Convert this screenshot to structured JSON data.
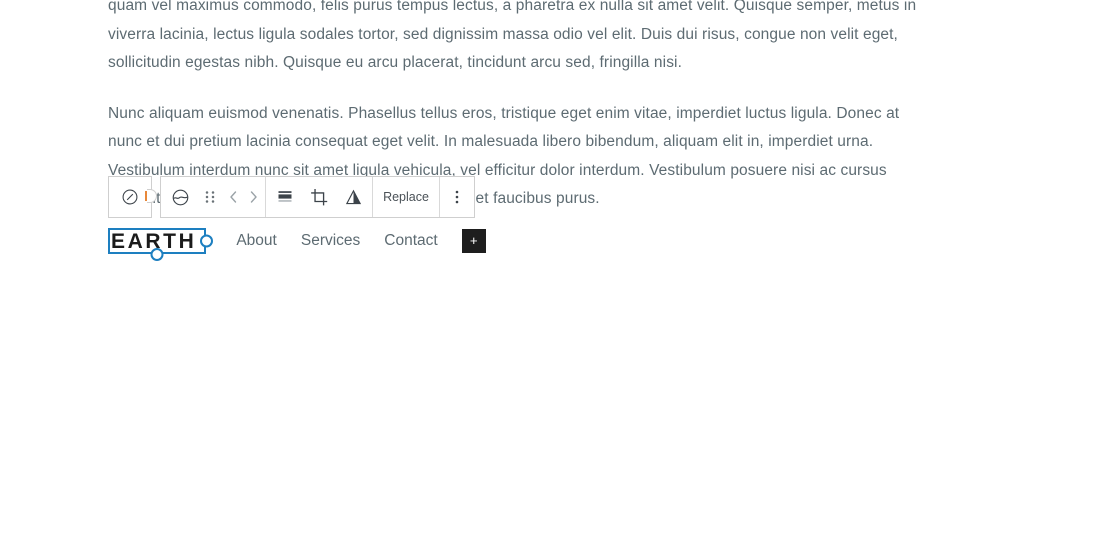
{
  "document": {
    "paragraphs": [
      "quam vel maximus commodo, felis purus tempus lectus, a pharetra ex nulla sit amet velit. Quisque semper, metus in viverra lacinia, lectus ligula sodales tortor, sed dignissim massa odio vel elit. Duis dui risus, congue non velit eget, sollicitudin egestas nibh. Quisque eu arcu placerat, tincidunt arcu sed, fringilla nisi.",
      "Nunc aliquam euismod venenatis. Phasellus tellus eros, tristique eget enim vitae, imperdiet luctus ligula. Donec at nunc et dui pretium lacinia consequat eget velit. In malesuada libero bibendum, aliquam elit in, imperdiet urna. Vestibulum interdum nunc sit amet ligula vehicula, vel efficitur dolor interdum. Vestibulum posuere nisi ac cursus suscipit. Donec porttitor, lacus nec lacinia finibus ex, et faucibus purus."
    ]
  },
  "block_toolbar": {
    "parent_block_label": "select-parent-block",
    "block_type_label": "image-block",
    "drag_label": "drag-handle",
    "move_prev_label": "‹",
    "move_next_label": "›",
    "align_label": "align",
    "crop_label": "crop",
    "filter_label": "duotone-filter",
    "replace_label": "Replace",
    "more_label": "more-options"
  },
  "site_header": {
    "logo_text": "EARTH",
    "nav_items": [
      {
        "label": "About"
      },
      {
        "label": "Services"
      },
      {
        "label": "Contact"
      }
    ],
    "add_block_label": "+"
  },
  "colors": {
    "selection_blue": "#1d7fc0",
    "toolbar_border": "#cfcfcf",
    "body_text": "#5d6b72",
    "logo_text": "#1b1b1b",
    "add_button_bg": "#1e1e1e",
    "icon": "#3c434a"
  }
}
